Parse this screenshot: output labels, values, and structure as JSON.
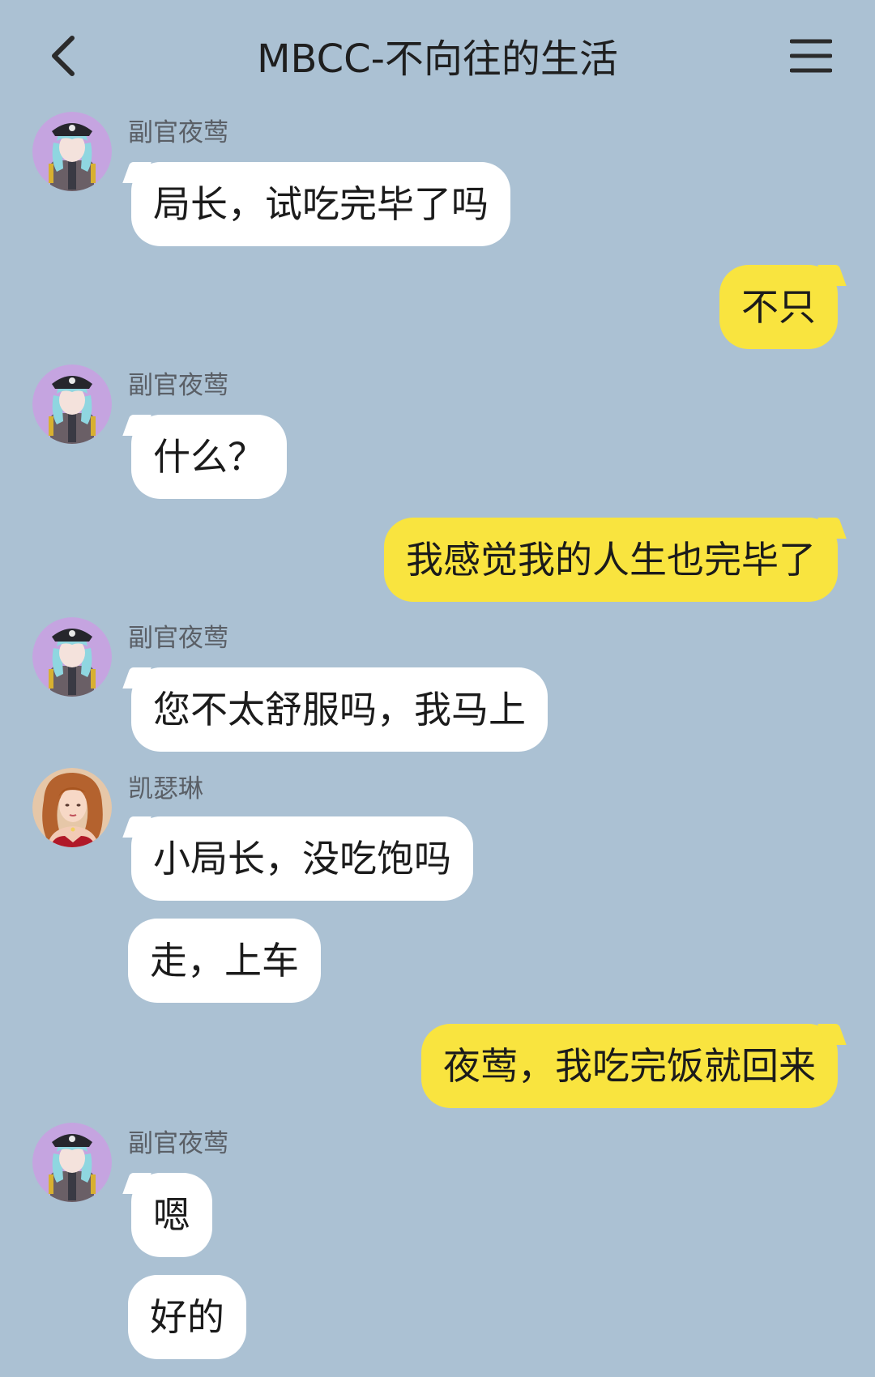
{
  "header": {
    "title": "MBCC-不向往的生活",
    "back_icon": "chevron-left-icon",
    "menu_icon": "hamburger-menu-icon"
  },
  "colors": {
    "background": "#abc1d3",
    "incoming_bubble": "#ffffff",
    "outgoing_bubble": "#f9e43f"
  },
  "messages": [
    {
      "direction": "in",
      "sender": "副官夜莺",
      "text": "局长，试吃完毕了吗",
      "avatar": "nightingale-avatar"
    },
    {
      "direction": "out",
      "text": "不只"
    },
    {
      "direction": "in",
      "sender": "副官夜莺",
      "text": "什么？",
      "avatar": "nightingale-avatar"
    },
    {
      "direction": "out",
      "text": "我感觉我的人生也完毕了"
    },
    {
      "direction": "in",
      "sender": "副官夜莺",
      "text": "您不太舒服吗，我马上",
      "avatar": "nightingale-avatar"
    },
    {
      "direction": "in",
      "sender": "凯瑟琳",
      "text": "小局长，没吃饱吗",
      "avatar": "catherine-avatar"
    },
    {
      "direction": "in",
      "text": "走，上车"
    },
    {
      "direction": "out",
      "text": "夜莺，我吃完饭就回来"
    },
    {
      "direction": "in",
      "sender": "副官夜莺",
      "text": "嗯",
      "avatar": "nightingale-avatar"
    },
    {
      "direction": "in",
      "text": "好的"
    }
  ]
}
